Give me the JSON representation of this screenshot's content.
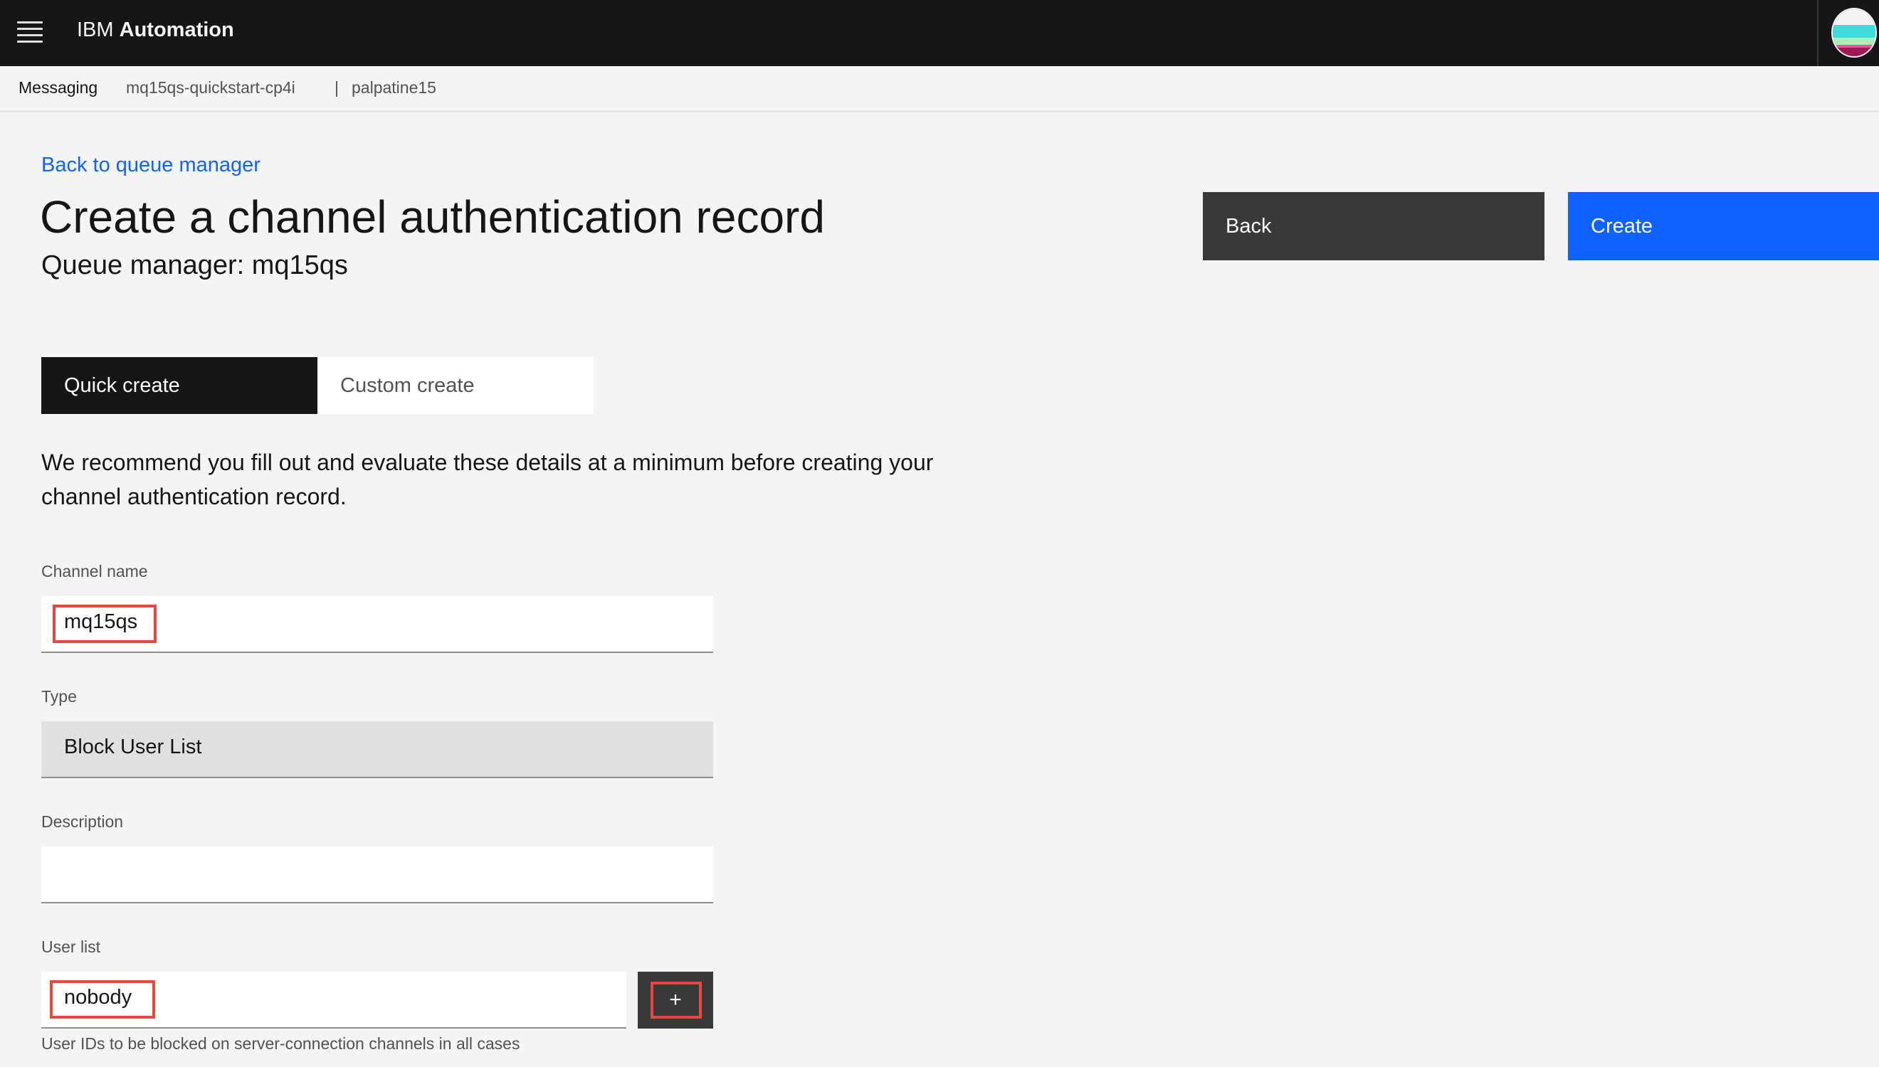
{
  "header": {
    "brand_prefix": "IBM",
    "brand_name": "Automation",
    "menu_icon": "hamburger-menu-icon",
    "avatar_icon": "user-avatar-icon",
    "background_color": "#161616"
  },
  "breadcrumb": {
    "root": "Messaging",
    "namespace": "mq15qs-quickstart-cp4i",
    "separator": "|",
    "user": "palpatine15"
  },
  "page": {
    "back_link": "Back to queue manager",
    "title": "Create a channel authentication record",
    "subtitle": "Queue manager: mq15qs"
  },
  "actions": {
    "back_label": "Back",
    "create_label": "Create",
    "create_color": "#0f62fe",
    "back_color": "#393939"
  },
  "tabs": [
    {
      "label": "Quick create",
      "selected": true
    },
    {
      "label": "Custom create",
      "selected": false
    }
  ],
  "intro": "We recommend you fill out and evaluate these details at a minimum before creating your channel authentication record.",
  "form": {
    "channel_name": {
      "label": "Channel name",
      "value": "mq15qs"
    },
    "type": {
      "label": "Type",
      "value": "Block User List"
    },
    "description": {
      "label": "Description",
      "value": ""
    },
    "user_list": {
      "label": "User list",
      "value": "nobody",
      "add_icon": "plus-icon",
      "add_glyph": "+",
      "helper": "User IDs to be blocked on server-connection channels in all cases"
    }
  },
  "highlight_color": "#e8473b"
}
